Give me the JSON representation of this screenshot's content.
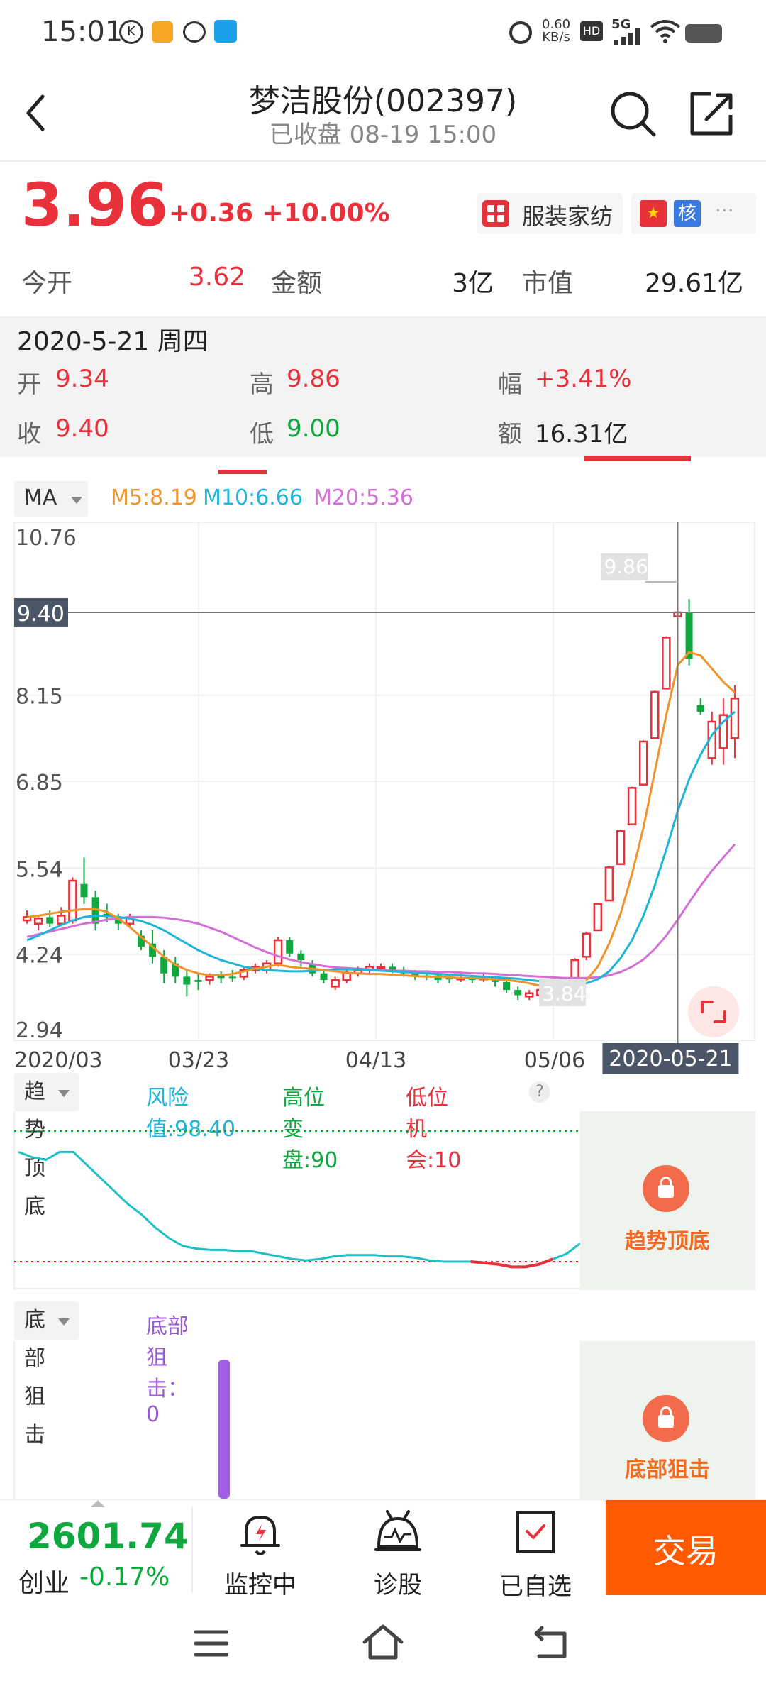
{
  "status_bar": {
    "time": "15:01",
    "net_speed": "0.60",
    "net_unit": "KB/s",
    "hd": "HD",
    "network": "5G"
  },
  "header": {
    "title": "梦洁股份(002397)",
    "subtitle": "已收盘 08-19 15:00"
  },
  "quote": {
    "price": "3.96",
    "change": "+0.36 +10.00%",
    "industry": "服装家纺",
    "tag_core": "核",
    "stats": [
      {
        "label": "今开",
        "value": "3.62"
      },
      {
        "label": "金额",
        "value": "3亿"
      },
      {
        "label": "市值",
        "value": "29.61亿"
      }
    ]
  },
  "tooltip": {
    "date": "2020-5-21 周四",
    "open_label": "开",
    "open": "9.34",
    "high_label": "高",
    "high": "9.86",
    "amp_label": "幅",
    "amp": "+3.41%",
    "close_label": "收",
    "close": "9.40",
    "low_label": "低",
    "low": "9.00",
    "amount_label": "额",
    "amount": "16.31亿"
  },
  "ma": {
    "selector": "MA",
    "m5": "M5:8.19",
    "m10": "M10:6.66",
    "m20": "M20:5.36"
  },
  "colors": {
    "up": "#e8313a",
    "down": "#0fa83e",
    "m5": "#f0932b",
    "m10": "#1fb5d8",
    "m20": "#d46fd6",
    "trade": "#ff5a00"
  },
  "chart_data": {
    "type": "candlestick",
    "y_ticks": [
      "10.76",
      "8.15",
      "6.85",
      "5.54",
      "4.24",
      "2.94"
    ],
    "x_ticks": [
      "2020/03",
      "03/23",
      "04/13",
      "05/06"
    ],
    "ylim": [
      2.94,
      10.76
    ],
    "crosshair": {
      "price": "9.40",
      "date": "2020-05-21"
    },
    "max_label": "9.86",
    "min_label": "3.84",
    "candles": [
      [
        4.75,
        4.8,
        4.9,
        4.7
      ],
      [
        4.7,
        4.78,
        4.8,
        4.6
      ],
      [
        4.8,
        4.7,
        4.9,
        4.65
      ],
      [
        4.7,
        4.82,
        4.95,
        4.68
      ],
      [
        4.75,
        5.35,
        5.4,
        4.7
      ],
      [
        5.3,
        5.1,
        5.7,
        5.0
      ],
      [
        5.1,
        4.7,
        5.2,
        4.6
      ],
      [
        4.85,
        4.8,
        5.0,
        4.72
      ],
      [
        4.8,
        4.7,
        4.85,
        4.6
      ],
      [
        4.7,
        4.8,
        4.85,
        4.65
      ],
      [
        4.52,
        4.35,
        4.6,
        4.3
      ],
      [
        4.4,
        4.2,
        4.6,
        4.1
      ],
      [
        4.2,
        3.95,
        4.3,
        3.8
      ],
      [
        4.1,
        3.9,
        4.2,
        3.8
      ],
      [
        3.9,
        3.78,
        4.0,
        3.6
      ],
      [
        3.85,
        3.82,
        3.95,
        3.7
      ],
      [
        3.85,
        3.9,
        3.95,
        3.78
      ],
      [
        3.92,
        3.88,
        3.98,
        3.8
      ],
      [
        3.9,
        3.88,
        4.0,
        3.82
      ],
      [
        3.9,
        4.0,
        4.05,
        3.85
      ],
      [
        4.0,
        4.05,
        4.1,
        3.95
      ],
      [
        4.0,
        4.1,
        4.15,
        3.95
      ],
      [
        4.1,
        4.45,
        4.5,
        4.05
      ],
      [
        4.45,
        4.25,
        4.5,
        4.2
      ],
      [
        4.25,
        4.15,
        4.3,
        4.05
      ],
      [
        4.1,
        3.95,
        4.15,
        3.9
      ],
      [
        3.95,
        3.85,
        4.0,
        3.8
      ],
      [
        3.75,
        3.85,
        3.9,
        3.7
      ],
      [
        3.85,
        3.95,
        4.0,
        3.8
      ],
      [
        3.95,
        4.0,
        4.05,
        3.9
      ],
      [
        4.0,
        4.05,
        4.1,
        3.95
      ],
      [
        4.05,
        4.05,
        4.1,
        4.0
      ],
      [
        4.05,
        4.0,
        4.1,
        3.95
      ],
      [
        4.0,
        3.95,
        4.05,
        3.9
      ],
      [
        3.95,
        3.92,
        4.0,
        3.85
      ],
      [
        3.92,
        3.9,
        3.95,
        3.85
      ],
      [
        3.92,
        3.85,
        3.98,
        3.8
      ],
      [
        3.88,
        3.86,
        3.92,
        3.8
      ],
      [
        3.86,
        3.88,
        3.92,
        3.82
      ],
      [
        3.88,
        3.85,
        3.92,
        3.8
      ],
      [
        3.86,
        3.88,
        3.95,
        3.82
      ],
      [
        3.85,
        3.82,
        3.9,
        3.75
      ],
      [
        3.82,
        3.7,
        3.85,
        3.65
      ],
      [
        3.7,
        3.62,
        3.75,
        3.55
      ],
      [
        3.6,
        3.65,
        3.7,
        3.55
      ],
      [
        3.62,
        3.7,
        3.72,
        3.58
      ],
      [
        3.68,
        3.72,
        3.78,
        3.65
      ],
      [
        3.72,
        3.75,
        3.8,
        3.68
      ],
      [
        3.75,
        4.15,
        4.18,
        3.72
      ],
      [
        4.2,
        4.55,
        4.58,
        4.15
      ],
      [
        4.6,
        5.0,
        5.02,
        4.6
      ],
      [
        5.05,
        5.55,
        5.57,
        5.05
      ],
      [
        5.6,
        6.1,
        6.12,
        5.6
      ],
      [
        6.2,
        6.75,
        6.77,
        6.2
      ],
      [
        6.8,
        7.45,
        7.47,
        6.8
      ],
      [
        7.5,
        8.2,
        8.22,
        7.5
      ],
      [
        8.25,
        9.02,
        9.04,
        8.25
      ],
      [
        9.34,
        9.4,
        9.86,
        9.0
      ],
      [
        9.4,
        8.7,
        9.6,
        8.6
      ],
      [
        8.0,
        7.9,
        8.1,
        7.85
      ],
      [
        7.2,
        7.75,
        7.9,
        7.1
      ],
      [
        7.35,
        7.85,
        8.1,
        7.1
      ],
      [
        7.5,
        8.1,
        8.3,
        7.2
      ]
    ],
    "ma5": [
      4.8,
      4.82,
      4.85,
      4.88,
      4.9,
      4.92,
      4.92,
      4.88,
      4.78,
      4.65,
      4.5,
      4.35,
      4.2,
      4.08,
      4.0,
      3.95,
      3.92,
      3.92,
      3.94,
      3.98,
      4.02,
      4.05,
      4.08,
      4.05,
      4.03,
      4.02,
      4.0,
      3.98,
      3.96,
      3.95,
      3.94,
      3.94,
      3.93,
      3.92,
      3.91,
      3.9,
      3.9,
      3.89,
      3.88,
      3.88,
      3.87,
      3.86,
      3.85,
      3.83,
      3.8,
      3.76,
      3.73,
      3.72,
      3.75,
      3.85,
      4.05,
      4.4,
      4.85,
      5.45,
      6.15,
      7.0,
      7.85,
      8.6,
      8.8,
      8.75,
      8.55,
      8.35,
      8.19
    ],
    "ma10": [
      4.45,
      4.52,
      4.6,
      4.68,
      4.75,
      4.8,
      4.82,
      4.82,
      4.8,
      4.78,
      4.74,
      4.68,
      4.6,
      4.5,
      4.4,
      4.3,
      4.22,
      4.15,
      4.1,
      4.05,
      4.02,
      4.0,
      3.99,
      3.98,
      3.98,
      3.99,
      4.0,
      4.01,
      4.01,
      4.01,
      4.0,
      3.99,
      3.98,
      3.97,
      3.96,
      3.95,
      3.94,
      3.93,
      3.92,
      3.91,
      3.9,
      3.89,
      3.88,
      3.87,
      3.85,
      3.83,
      3.81,
      3.79,
      3.78,
      3.8,
      3.86,
      3.98,
      4.18,
      4.45,
      4.82,
      5.28,
      5.82,
      6.4,
      6.88,
      7.25,
      7.55,
      7.75,
      7.9
    ],
    "ma20": [
      4.5,
      4.54,
      4.58,
      4.62,
      4.66,
      4.7,
      4.73,
      4.76,
      4.78,
      4.8,
      4.8,
      4.8,
      4.79,
      4.77,
      4.74,
      4.7,
      4.64,
      4.58,
      4.5,
      4.42,
      4.34,
      4.27,
      4.21,
      4.16,
      4.12,
      4.09,
      4.06,
      4.04,
      4.03,
      4.02,
      4.01,
      4.0,
      3.99,
      3.99,
      3.98,
      3.98,
      3.97,
      3.97,
      3.96,
      3.95,
      3.95,
      3.94,
      3.93,
      3.92,
      3.91,
      3.9,
      3.89,
      3.88,
      3.88,
      3.88,
      3.89,
      3.92,
      3.97,
      4.05,
      4.16,
      4.32,
      4.52,
      4.76,
      5.02,
      5.27,
      5.5,
      5.7,
      5.9
    ]
  },
  "trend_panel": {
    "selector": "趋势顶底",
    "risk": "风险值:98.40",
    "high_turn": "高位变盘:90",
    "low_chance": "低位机会:10",
    "help": "?",
    "locked_label": "趋势顶底",
    "curve": [
      0.84,
      0.8,
      0.78,
      0.84,
      0.84,
      0.74,
      0.64,
      0.54,
      0.44,
      0.36,
      0.26,
      0.18,
      0.12,
      0.1,
      0.09,
      0.09,
      0.08,
      0.08,
      0.06,
      0.04,
      0.02,
      0.01,
      0.02,
      0.04,
      0.05,
      0.05,
      0.05,
      0.04,
      0.04,
      0.03,
      0.01,
      0.0,
      0.0,
      0.0,
      -0.01,
      -0.02,
      -0.04,
      -0.04,
      -0.02,
      0.02,
      0.06,
      0.14
    ]
  },
  "bottom_panel": {
    "selector": "底部狙击",
    "value": "底部狙击：0",
    "locked_label": "底部狙击"
  },
  "bottom_bar": {
    "index_value": "2601.74",
    "index_name": "创业",
    "index_change": "-0.17%",
    "monitor": "监控中",
    "diagnose": "诊股",
    "watchlist": "已自选",
    "trade": "交易"
  }
}
